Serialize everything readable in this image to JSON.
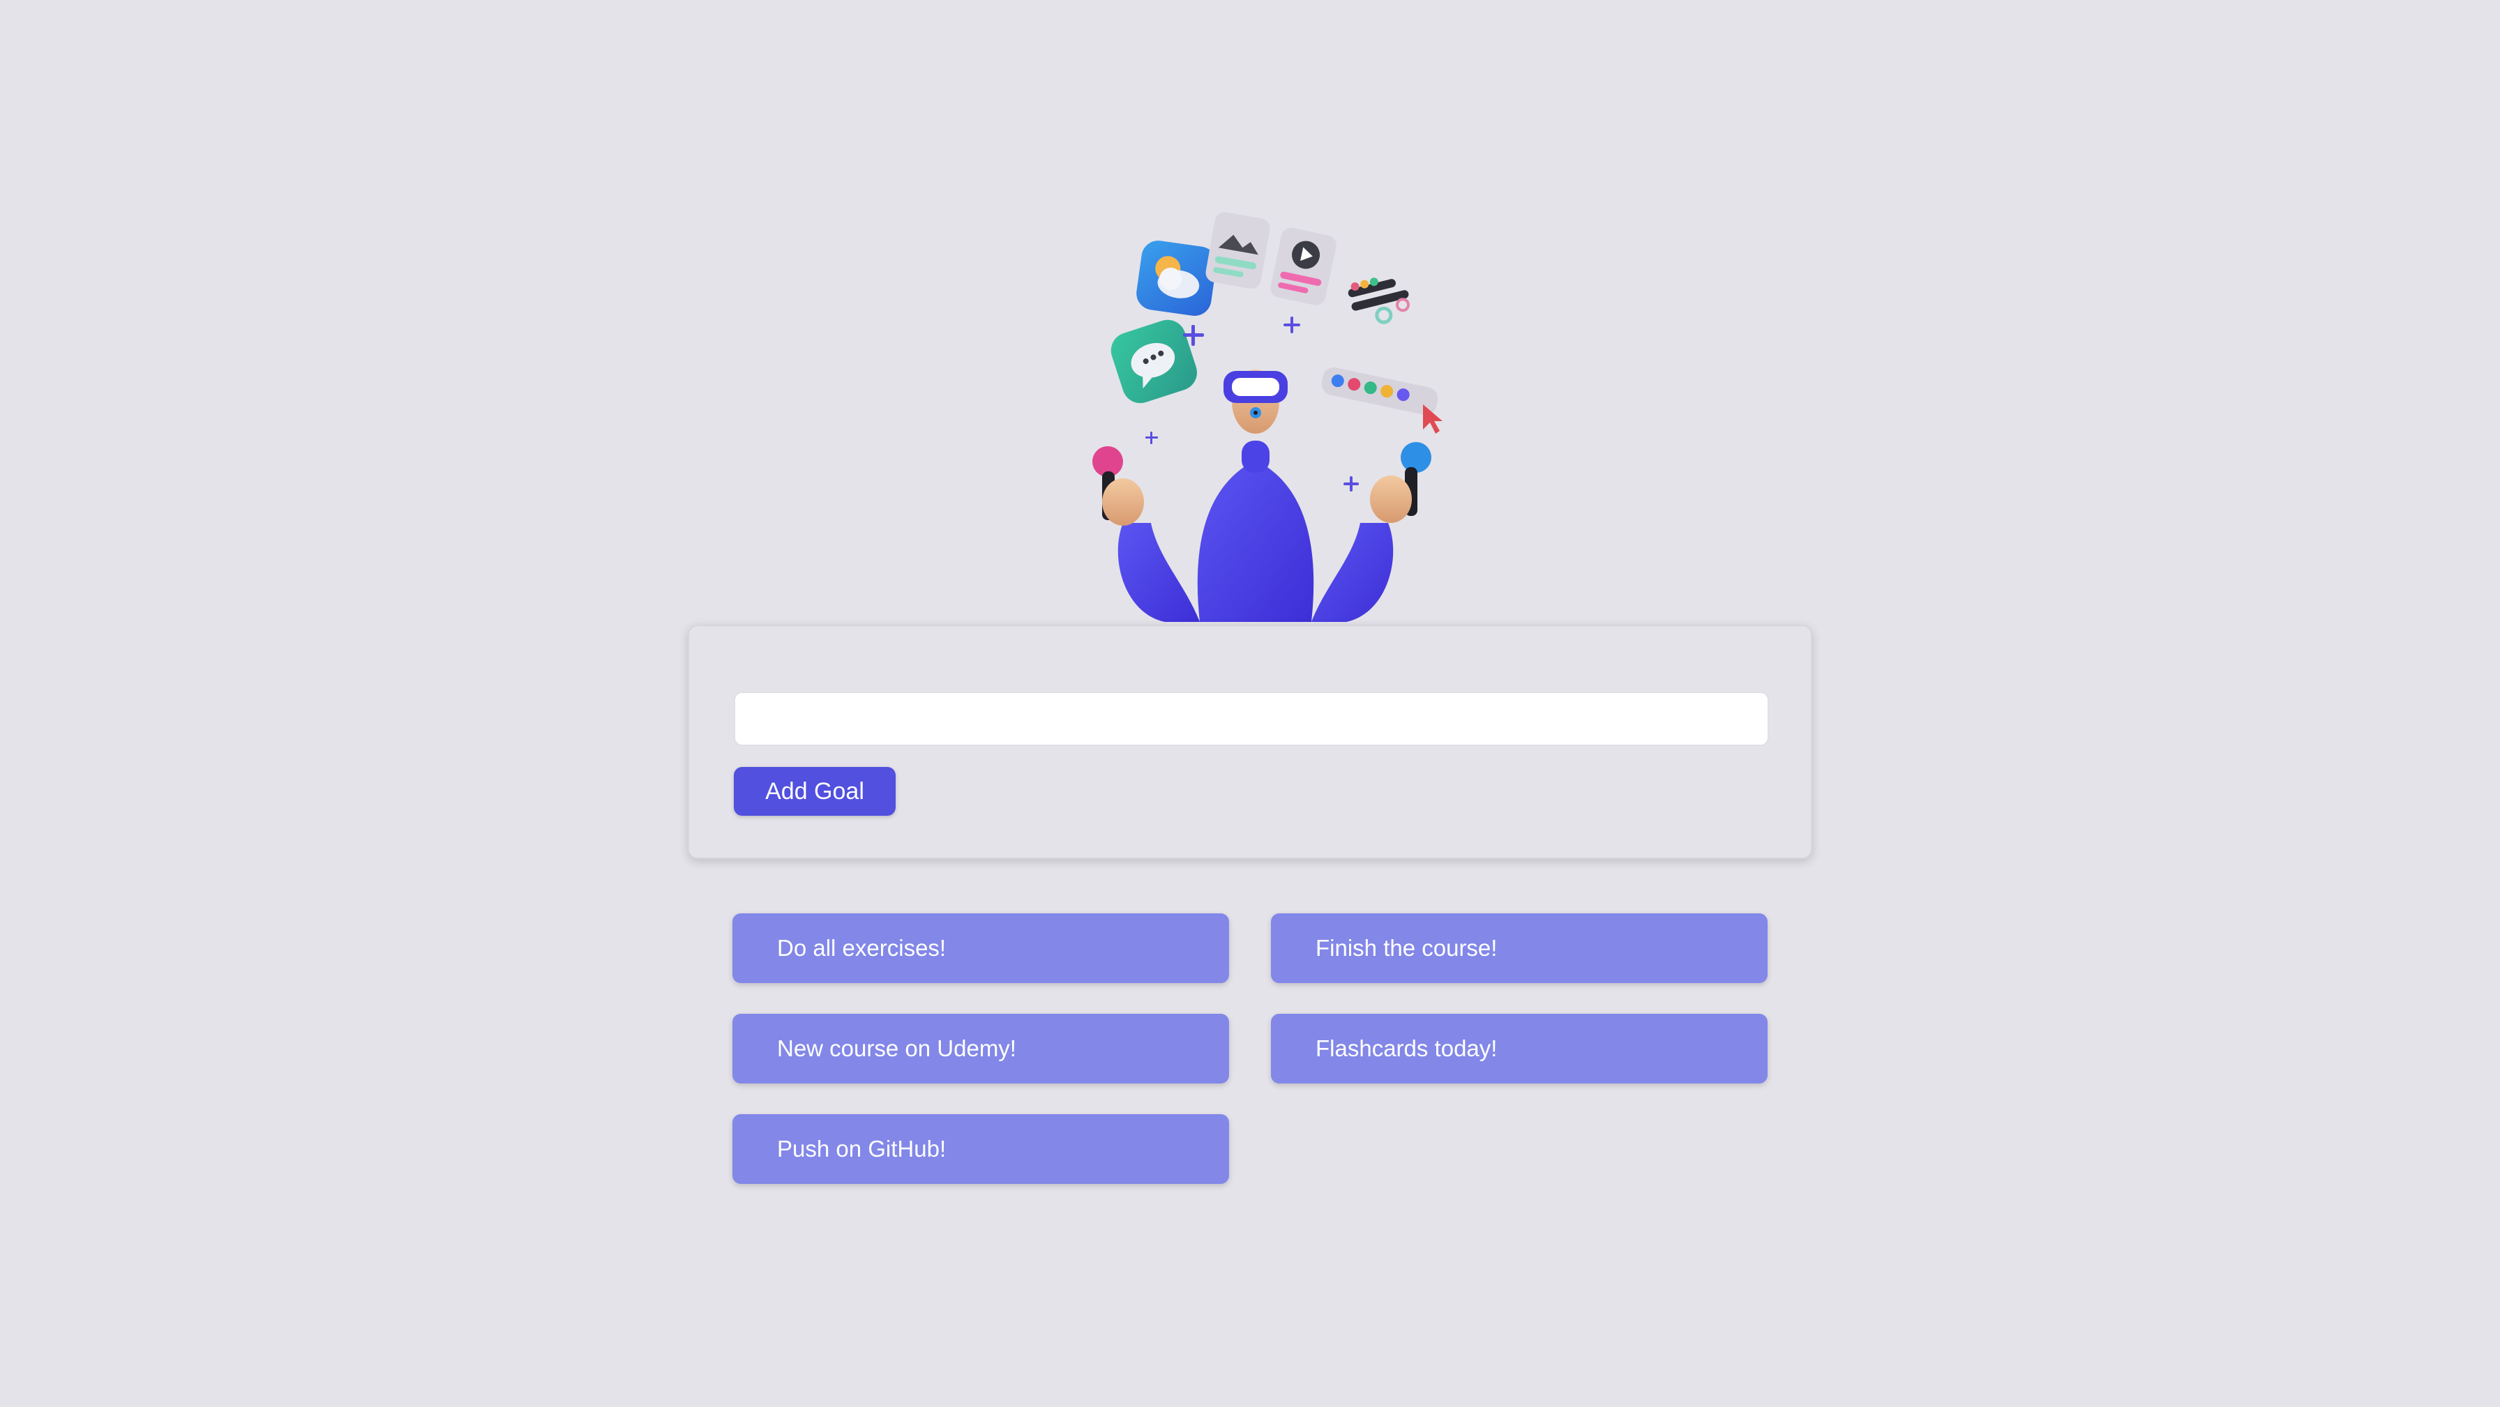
{
  "goal_form": {
    "input_value": "",
    "input_placeholder": "",
    "add_button_label": "Add Goal"
  },
  "goals": [
    {
      "label": "Do all exercises!"
    },
    {
      "label": "Finish the course!"
    },
    {
      "label": "New course on Udemy!"
    },
    {
      "label": "Flashcards today!"
    },
    {
      "label": "Push on GitHub!"
    }
  ],
  "colors": {
    "background": "#e4e3e9",
    "accent": "#5150df",
    "goal_item": "#8287e8",
    "goal_text": "#ffffff"
  },
  "hero": {
    "icons": [
      "weather-icon",
      "image-icon",
      "play-icon",
      "chat-icon",
      "settings-sliders-icon",
      "color-palette-icon",
      "cursor-icon",
      "plus-icon"
    ]
  }
}
